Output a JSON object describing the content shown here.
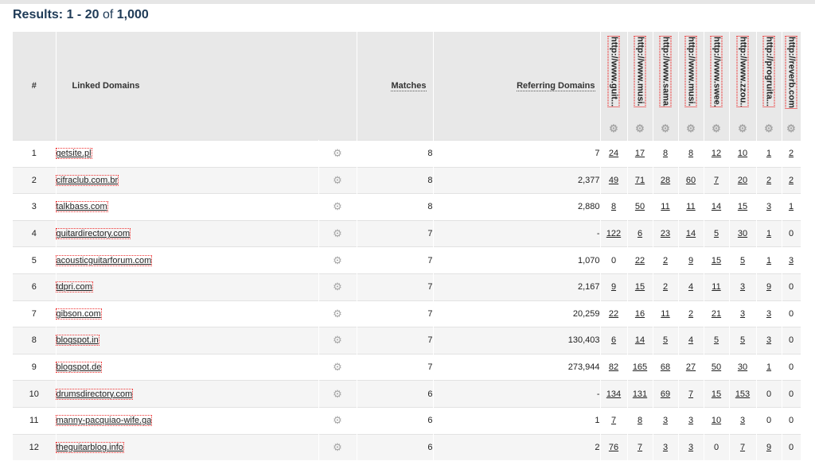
{
  "results": {
    "prefix": "Results:",
    "range": "1 - 20",
    "of": "of",
    "total": "1,000"
  },
  "columns": {
    "num": "#",
    "linked_domains": "Linked Domains",
    "matches": "Matches",
    "referring_domains": "Referring Domains",
    "sites": [
      "http://www.guit...",
      "http://www.musi...",
      "http://www.sama...",
      "http://www.musi...",
      "http://www.swee...",
      "http://www.zzou...",
      "http://progruita...",
      "http://reverb.com"
    ]
  },
  "rows": [
    {
      "n": "1",
      "domain": "getsite.pl",
      "matches": "8",
      "ref": "7",
      "vals": [
        "24",
        "17",
        "8",
        "8",
        "12",
        "10",
        "1",
        "2"
      ],
      "links": [
        1,
        1,
        1,
        1,
        1,
        1,
        1,
        1
      ]
    },
    {
      "n": "2",
      "domain": "cifraclub.com.br",
      "matches": "8",
      "ref": "2,377",
      "vals": [
        "49",
        "71",
        "28",
        "60",
        "7",
        "20",
        "2",
        "2"
      ],
      "links": [
        1,
        1,
        1,
        1,
        1,
        1,
        1,
        1
      ]
    },
    {
      "n": "3",
      "domain": "talkbass.com",
      "matches": "8",
      "ref": "2,880",
      "vals": [
        "8",
        "50",
        "11",
        "11",
        "14",
        "15",
        "3",
        "1"
      ],
      "links": [
        1,
        1,
        1,
        1,
        1,
        1,
        1,
        1
      ]
    },
    {
      "n": "4",
      "domain": "guitardirectory.com",
      "matches": "7",
      "ref": "-",
      "vals": [
        "122",
        "6",
        "23",
        "14",
        "5",
        "30",
        "1",
        "0"
      ],
      "links": [
        1,
        1,
        1,
        1,
        1,
        1,
        1,
        0
      ]
    },
    {
      "n": "5",
      "domain": "acousticguitarforum.com",
      "matches": "7",
      "ref": "1,070",
      "vals": [
        "0",
        "22",
        "2",
        "9",
        "15",
        "5",
        "1",
        "3"
      ],
      "links": [
        0,
        1,
        1,
        1,
        1,
        1,
        1,
        1
      ]
    },
    {
      "n": "6",
      "domain": "tdpri.com",
      "matches": "7",
      "ref": "2,167",
      "vals": [
        "9",
        "15",
        "2",
        "4",
        "11",
        "3",
        "9",
        "0"
      ],
      "links": [
        1,
        1,
        1,
        1,
        1,
        1,
        1,
        0
      ]
    },
    {
      "n": "7",
      "domain": "gibson.com",
      "matches": "7",
      "ref": "20,259",
      "vals": [
        "22",
        "16",
        "11",
        "2",
        "21",
        "3",
        "3",
        "0"
      ],
      "links": [
        1,
        1,
        1,
        1,
        1,
        1,
        1,
        0
      ]
    },
    {
      "n": "8",
      "domain": "blogspot.in",
      "matches": "7",
      "ref": "130,403",
      "vals": [
        "6",
        "14",
        "5",
        "4",
        "5",
        "5",
        "3",
        "0"
      ],
      "links": [
        1,
        1,
        1,
        1,
        1,
        1,
        1,
        0
      ]
    },
    {
      "n": "9",
      "domain": "blogspot.de",
      "matches": "7",
      "ref": "273,944",
      "vals": [
        "82",
        "165",
        "68",
        "27",
        "50",
        "30",
        "1",
        "0"
      ],
      "links": [
        1,
        1,
        1,
        1,
        1,
        1,
        1,
        0
      ]
    },
    {
      "n": "10",
      "domain": "drumsdirectory.com",
      "matches": "6",
      "ref": "-",
      "vals": [
        "134",
        "131",
        "69",
        "7",
        "15",
        "153",
        "0",
        "0"
      ],
      "links": [
        1,
        1,
        1,
        1,
        1,
        1,
        0,
        0
      ]
    },
    {
      "n": "11",
      "domain": "manny-pacquiao-wife.ga",
      "matches": "6",
      "ref": "1",
      "vals": [
        "7",
        "8",
        "3",
        "3",
        "10",
        "3",
        "0",
        "0"
      ],
      "links": [
        1,
        1,
        1,
        1,
        1,
        1,
        0,
        0
      ]
    },
    {
      "n": "12",
      "domain": "theguitarblog.info",
      "matches": "6",
      "ref": "2",
      "vals": [
        "76",
        "7",
        "3",
        "3",
        "0",
        "7",
        "9",
        "0"
      ],
      "links": [
        1,
        1,
        1,
        1,
        0,
        1,
        1,
        0
      ]
    }
  ],
  "icons": {
    "gear": "gear-icon"
  }
}
